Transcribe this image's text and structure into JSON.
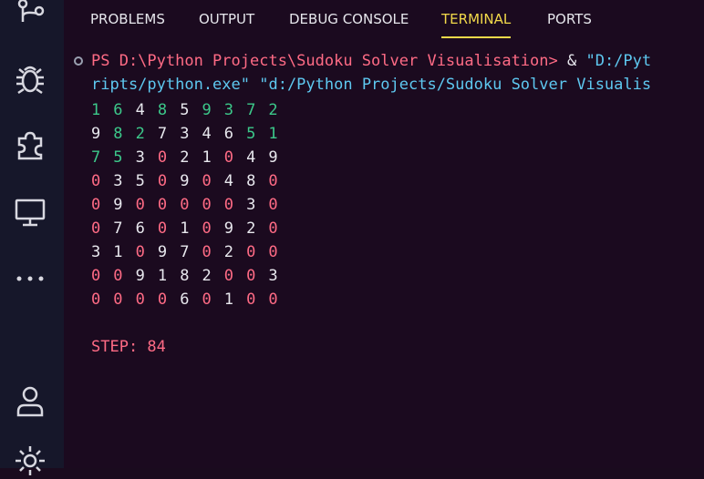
{
  "activity_bar": {
    "icons": [
      "source-control-icon",
      "debug-icon",
      "extensions-icon",
      "remote-explorer-icon",
      "more-icon",
      "account-icon",
      "settings-icon"
    ]
  },
  "tabs": [
    {
      "label": "PROBLEMS",
      "active": false
    },
    {
      "label": "OUTPUT",
      "active": false
    },
    {
      "label": "DEBUG CONSOLE",
      "active": false
    },
    {
      "label": "TERMINAL",
      "active": true
    },
    {
      "label": "PORTS",
      "active": false
    }
  ],
  "terminal": {
    "prompt_line1_red": "PS D:\\Python Projects\\Sudoku Solver Visualisation>",
    "prompt_line1_amp": " & ",
    "prompt_line1_blue": "\"D:/Pyt",
    "prompt_line2_blue1": "ripts/python.exe\"",
    "prompt_line2_blue2": " \"d:/Python Projects/Sudoku Solver Visualis",
    "grid": [
      [
        [
          "1",
          "g"
        ],
        [
          "6",
          "g"
        ],
        [
          "4",
          "w"
        ],
        [
          "8",
          "g"
        ],
        [
          "5",
          "w"
        ],
        [
          "9",
          "g"
        ],
        [
          "3",
          "g"
        ],
        [
          "7",
          "g"
        ],
        [
          "2",
          "g"
        ]
      ],
      [
        [
          "9",
          "w"
        ],
        [
          "8",
          "g"
        ],
        [
          "2",
          "g"
        ],
        [
          "7",
          "w"
        ],
        [
          "3",
          "w"
        ],
        [
          "4",
          "w"
        ],
        [
          "6",
          "w"
        ],
        [
          "5",
          "g"
        ],
        [
          "1",
          "g"
        ]
      ],
      [
        [
          "7",
          "g"
        ],
        [
          "5",
          "g"
        ],
        [
          "3",
          "w"
        ],
        [
          "0",
          "r"
        ],
        [
          "2",
          "w"
        ],
        [
          "1",
          "w"
        ],
        [
          "0",
          "r"
        ],
        [
          "4",
          "w"
        ],
        [
          "9",
          "w"
        ]
      ],
      [
        [
          "0",
          "r"
        ],
        [
          "3",
          "w"
        ],
        [
          "5",
          "w"
        ],
        [
          "0",
          "r"
        ],
        [
          "9",
          "w"
        ],
        [
          "0",
          "r"
        ],
        [
          "4",
          "w"
        ],
        [
          "8",
          "w"
        ],
        [
          "0",
          "r"
        ]
      ],
      [
        [
          "0",
          "r"
        ],
        [
          "9",
          "w"
        ],
        [
          "0",
          "r"
        ],
        [
          "0",
          "r"
        ],
        [
          "0",
          "r"
        ],
        [
          "0",
          "r"
        ],
        [
          "0",
          "r"
        ],
        [
          "3",
          "w"
        ],
        [
          "0",
          "r"
        ]
      ],
      [
        [
          "0",
          "r"
        ],
        [
          "7",
          "w"
        ],
        [
          "6",
          "w"
        ],
        [
          "0",
          "r"
        ],
        [
          "1",
          "w"
        ],
        [
          "0",
          "r"
        ],
        [
          "9",
          "w"
        ],
        [
          "2",
          "w"
        ],
        [
          "0",
          "r"
        ]
      ],
      [
        [
          "3",
          "w"
        ],
        [
          "1",
          "w"
        ],
        [
          "0",
          "r"
        ],
        [
          "9",
          "w"
        ],
        [
          "7",
          "w"
        ],
        [
          "0",
          "r"
        ],
        [
          "2",
          "w"
        ],
        [
          "0",
          "r"
        ],
        [
          "0",
          "r"
        ]
      ],
      [
        [
          "0",
          "r"
        ],
        [
          "0",
          "r"
        ],
        [
          "9",
          "w"
        ],
        [
          "1",
          "w"
        ],
        [
          "8",
          "w"
        ],
        [
          "2",
          "w"
        ],
        [
          "0",
          "r"
        ],
        [
          "0",
          "r"
        ],
        [
          "3",
          "w"
        ]
      ],
      [
        [
          "0",
          "r"
        ],
        [
          "0",
          "r"
        ],
        [
          "0",
          "r"
        ],
        [
          "0",
          "r"
        ],
        [
          "6",
          "w"
        ],
        [
          "0",
          "r"
        ],
        [
          "1",
          "w"
        ],
        [
          "0",
          "r"
        ],
        [
          "0",
          "r"
        ]
      ]
    ],
    "step_text": "STEP: 84"
  },
  "colors": {
    "red": "#ff6b85",
    "white": "#e8e8ee",
    "blue": "#5ec8f0",
    "green": "#3cc88a",
    "active_tab": "#f2d94a"
  }
}
